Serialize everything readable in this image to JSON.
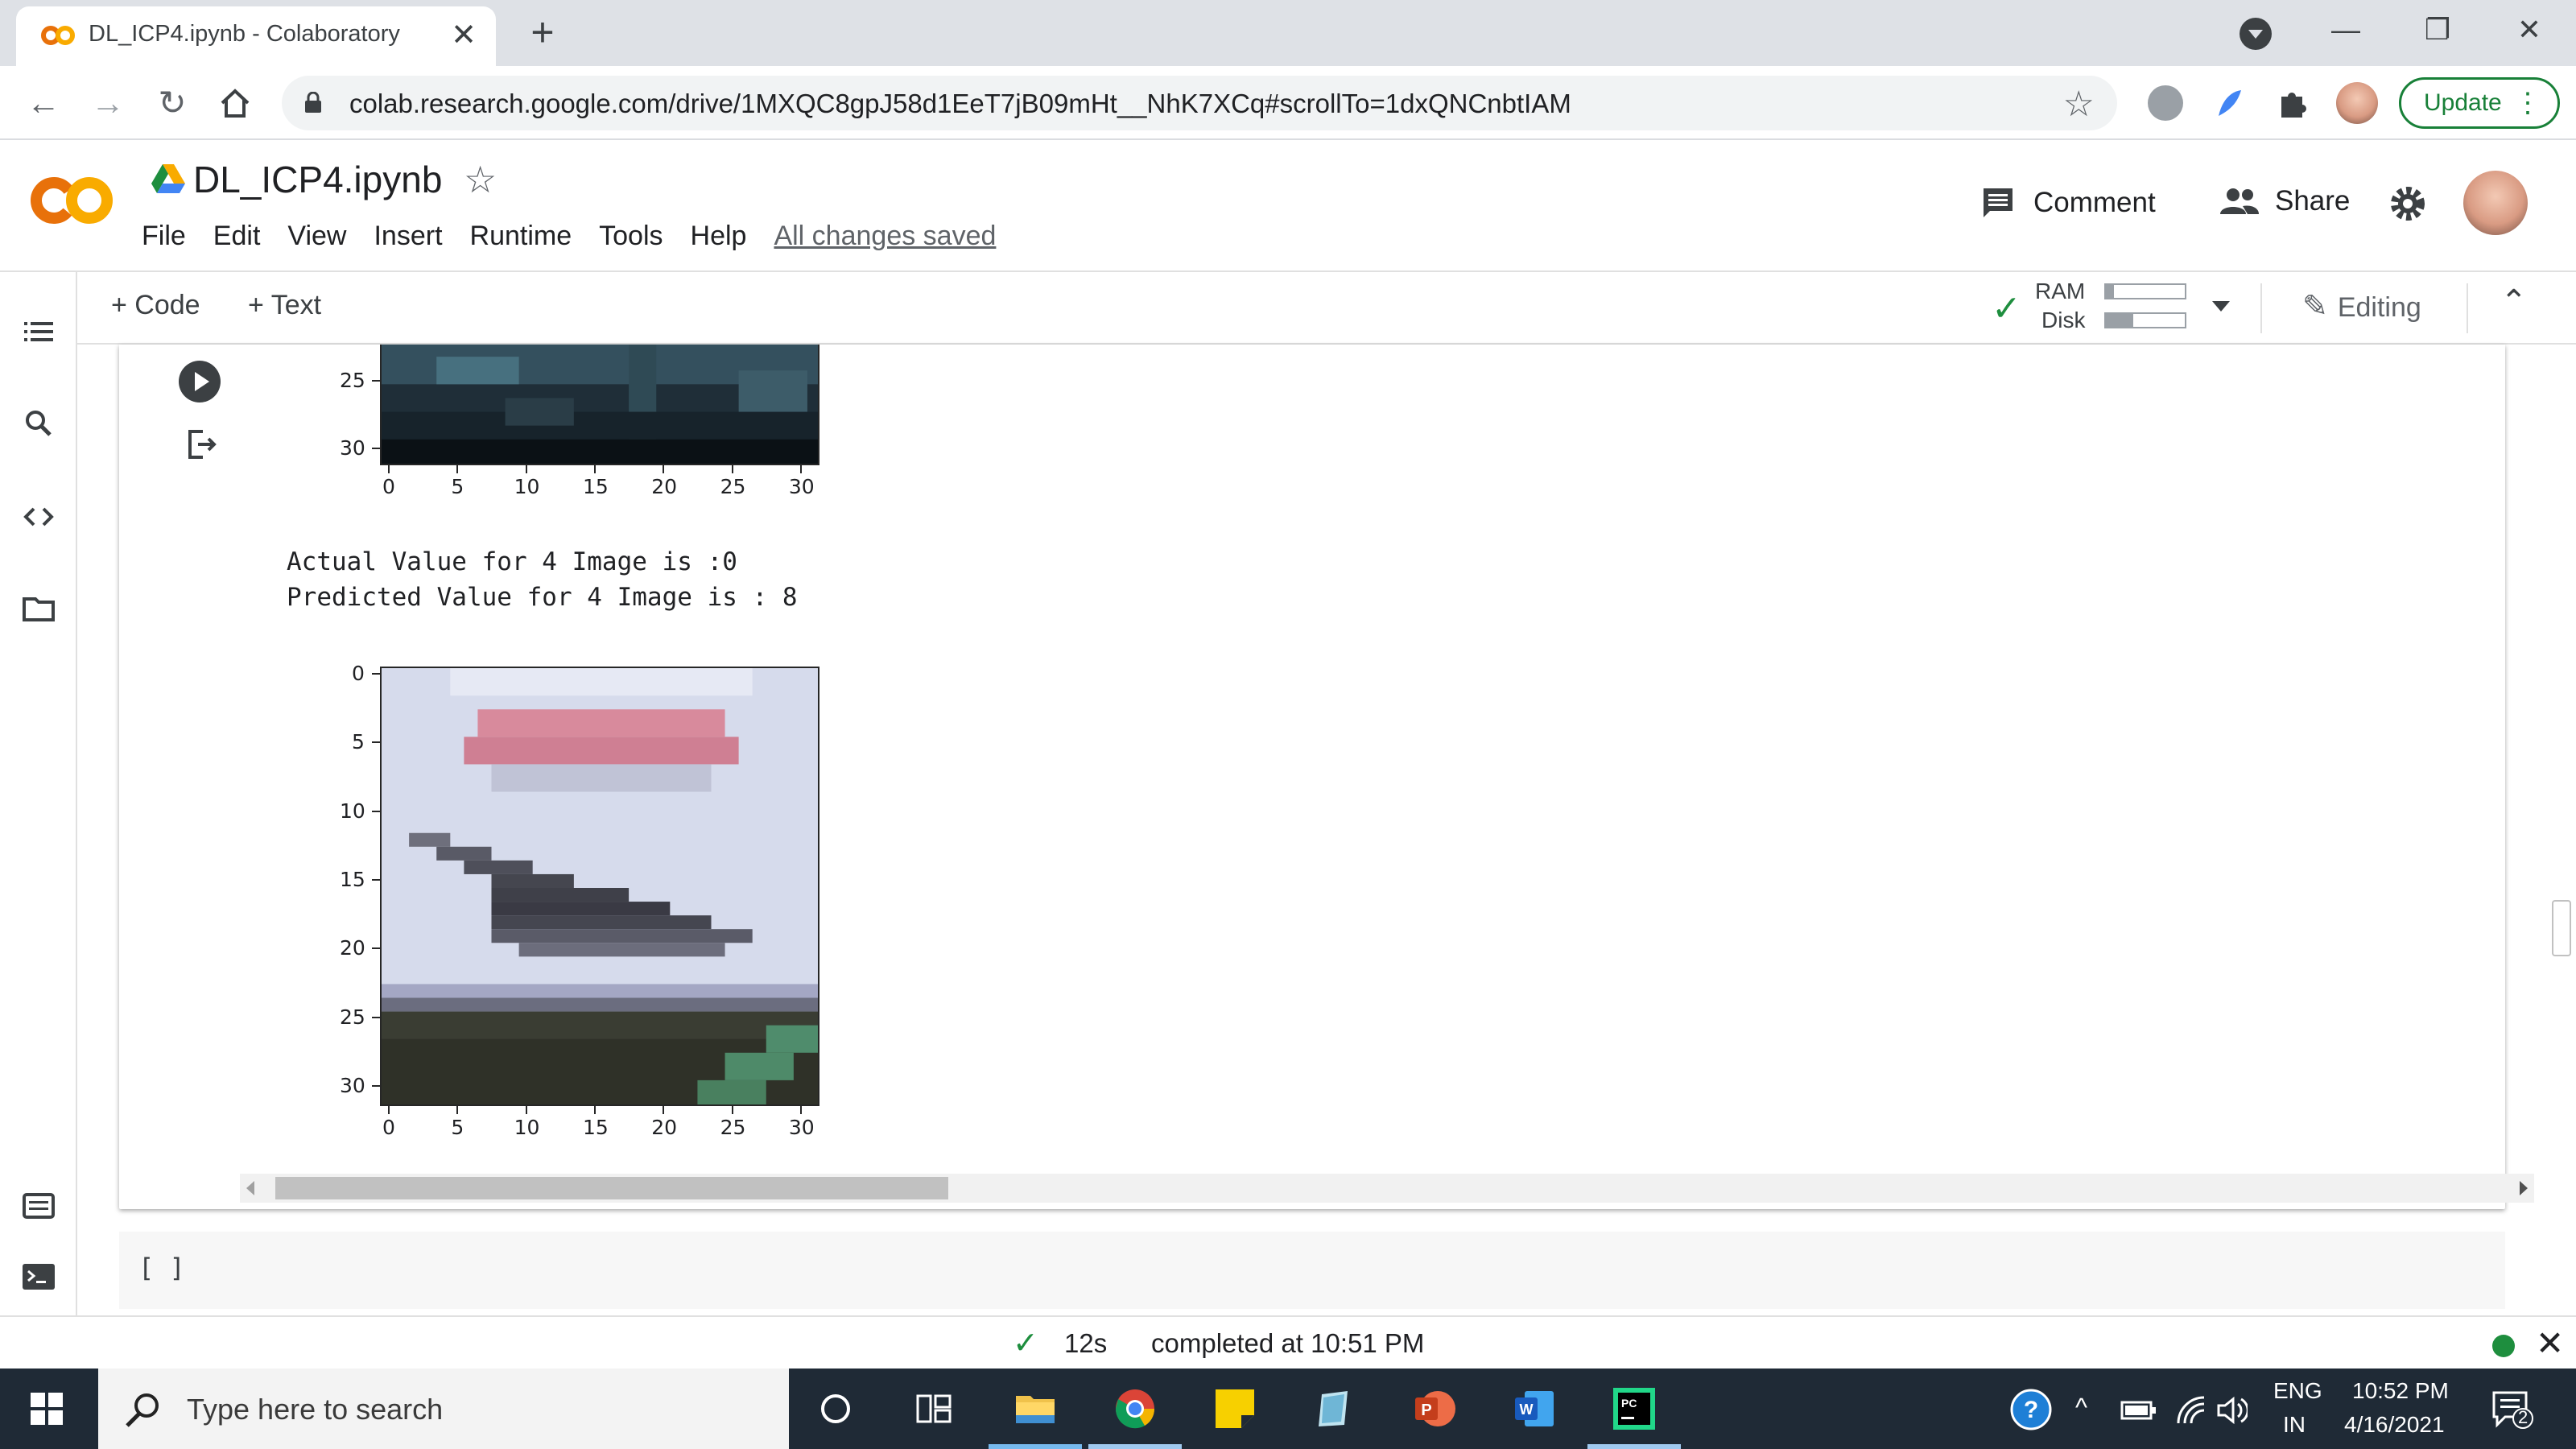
{
  "browser": {
    "tab_title": "DL_ICP4.ipynb - Colaboratory",
    "tab_close": "✕",
    "new_tab": "+",
    "url": "colab.research.google.com/drive/1MXQC8gpJ58d1EeT7jB09mHt__NhK7XCq#scrollTo=1dxQNCnbtIAM",
    "update_label": "Update",
    "minimize": "—",
    "maximize": "❐",
    "close": "✕"
  },
  "colab": {
    "logo_text": "CO",
    "doc_title": "DL_ICP4.ipynb",
    "menu": [
      "File",
      "Edit",
      "View",
      "Insert",
      "Runtime",
      "Tools",
      "Help"
    ],
    "saved_status": "All changes saved",
    "comment_label": "Comment",
    "share_label": "Share"
  },
  "notebook_toolbar": {
    "add_code": "+ Code",
    "add_text": "+ Text",
    "ram_label": "RAM",
    "disk_label": "Disk",
    "ram_usage": 0.1,
    "disk_usage": 0.35,
    "editing_label": "Editing"
  },
  "output": {
    "top_plot": {
      "y_ticks": [
        "25",
        "30"
      ],
      "x_ticks": [
        "0",
        "5",
        "10",
        "15",
        "20",
        "25",
        "30"
      ]
    },
    "text_lines": [
      "Actual Value for 4 Image is :0",
      "Predicted Value for 4 Image is : 8"
    ],
    "bottom_plot": {
      "y_ticks": [
        "0",
        "5",
        "10",
        "15",
        "20",
        "25",
        "30"
      ],
      "x_ticks": [
        "0",
        "5",
        "10",
        "15",
        "20",
        "25",
        "30"
      ]
    }
  },
  "empty_cell": "[ ]",
  "status_bar": {
    "duration": "12s",
    "message": "completed at 10:51 PM"
  },
  "taskbar": {
    "search_placeholder": "Type here to search",
    "language_top": "ENG",
    "language_bottom": "IN",
    "time": "10:52 PM",
    "date": "4/16/2021",
    "notification_count": "2"
  },
  "colors": {
    "colab_orange": "#f9ab00",
    "accent_green": "#188038",
    "taskbar": "#1f2a36"
  }
}
